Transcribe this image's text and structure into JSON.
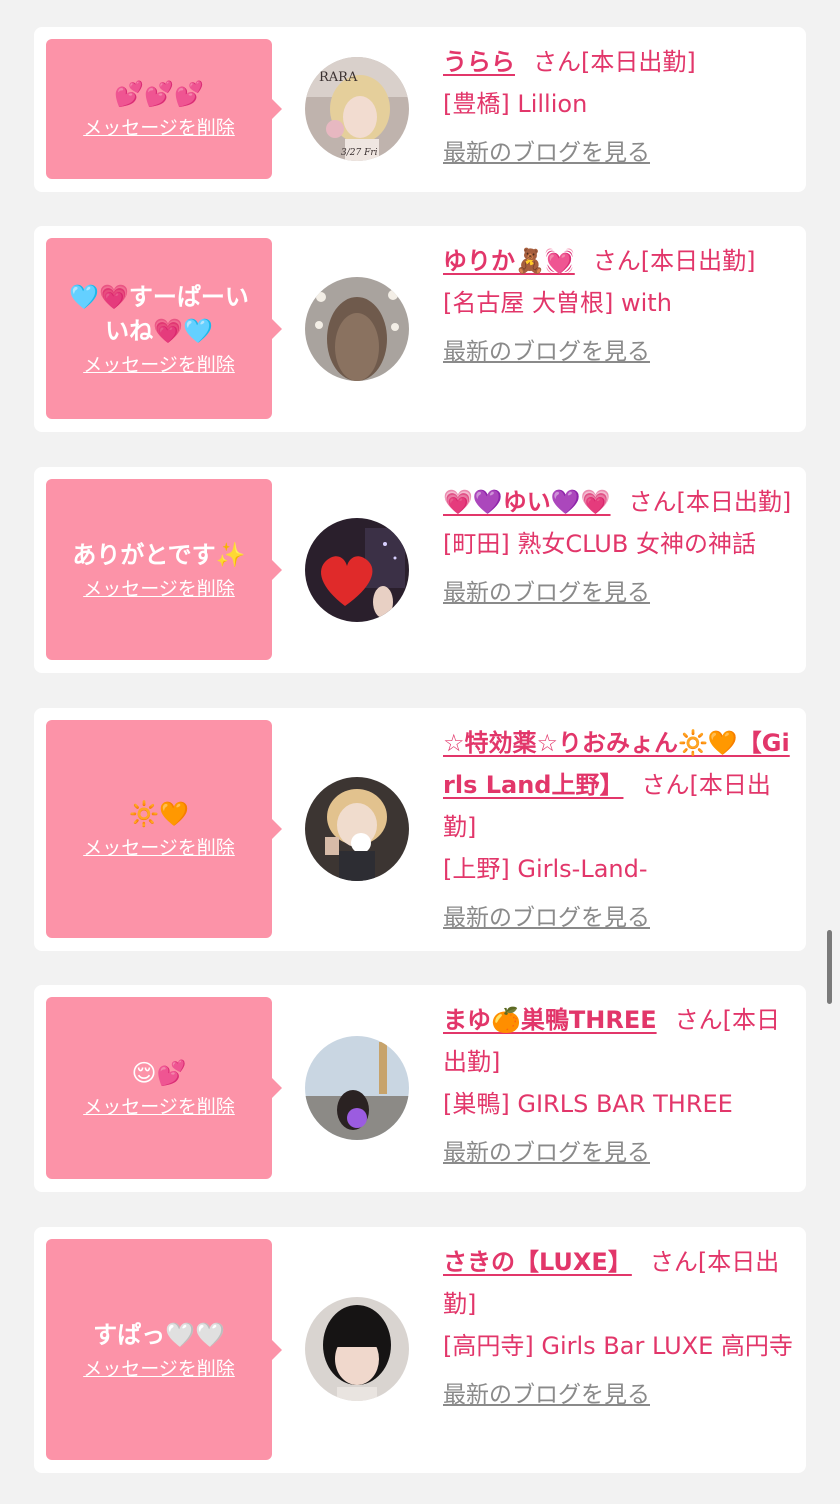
{
  "favorites": [
    {
      "message": "💕💕💕",
      "delete_label": "メッセージを削除",
      "name": "うらら",
      "suffix": "さん[本日出勤]",
      "area_shop": "[豊橋] Lillion",
      "blog_label": "最新のブログを見る",
      "avatar_text": "RARA",
      "avatar_text2": "3/27 Fri",
      "avatar_icon": "avatar-photo-icon"
    },
    {
      "message": "🩵💗すーぱーいいね💗🩵",
      "delete_label": "メッセージを削除",
      "name": "ゆりか🧸💓",
      "suffix": "さん[本日出勤]",
      "area_shop": "[名古屋 大曽根] with",
      "blog_label": "最新のブログを見る",
      "avatar_icon": "avatar-photo-icon"
    },
    {
      "message": "ありがとです✨",
      "delete_label": "メッセージを削除",
      "name": "💗💜ゆい💜💗",
      "suffix": "さん[本日出勤]",
      "area_shop": "[町田] 熟女CLUB 女神の神話",
      "blog_label": "最新のブログを見る",
      "avatar_icon": "avatar-photo-icon"
    },
    {
      "message": "🔆🧡",
      "delete_label": "メッセージを削除",
      "name": "☆特効薬☆りおみょん🔆🧡【Girls Land上野】",
      "suffix": "さん[本日出勤]",
      "area_shop": "[上野] Girls-Land-",
      "blog_label": "最新のブログを見る",
      "avatar_icon": "avatar-photo-icon"
    },
    {
      "message": "😌💕",
      "delete_label": "メッセージを削除",
      "name": "まゆ🍊巣鴨THREE",
      "suffix": "さん[本日出勤]",
      "area_shop": "[巣鴨] GIRLS BAR THREE",
      "blog_label": "最新のブログを見る",
      "avatar_icon": "avatar-photo-icon"
    },
    {
      "message": "すぱっ🤍🤍",
      "delete_label": "メッセージを削除",
      "name": "さきの【LUXE】",
      "suffix": "さん[本日出勤]",
      "area_shop": "[高円寺] Girls Bar LUXE 高円寺",
      "blog_label": "最新のブログを見る",
      "avatar_icon": "avatar-photo-icon"
    }
  ],
  "colors": {
    "page_bg": "#f2f2f2",
    "card_bg": "#ffffff",
    "bubble": "#fc93a8",
    "accent": "#e2366a",
    "link_gray": "#8a8a8a"
  }
}
